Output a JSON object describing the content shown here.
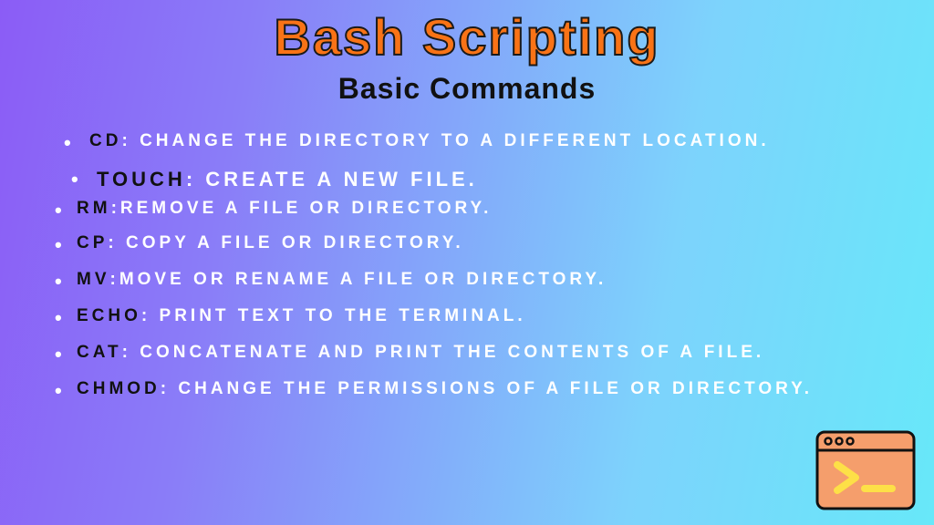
{
  "title": "Bash Scripting",
  "subtitle": "Basic Commands",
  "commands": [
    {
      "name": "CD",
      "sep": ": ",
      "desc": "CHANGE THE DIRECTORY TO A DIFFERENT LOCATION."
    },
    {
      "name": "TOUCH",
      "sep": ": ",
      "desc": "CREATE A NEW FILE."
    },
    {
      "name": "RM",
      "sep": ":",
      "desc": "REMOVE A FILE OR DIRECTORY."
    },
    {
      "name": "CP",
      "sep": ": ",
      "desc": "COPY A FILE OR DIRECTORY."
    },
    {
      "name": "MV",
      "sep": ":",
      "desc": "MOVE OR RENAME A FILE OR DIRECTORY."
    },
    {
      "name": "ECHO",
      "sep": ": ",
      "desc": "PRINT TEXT TO THE TERMINAL."
    },
    {
      "name": "CAT",
      "sep": ": ",
      "desc": "CONCATENATE AND PRINT THE CONTENTS OF A FILE."
    },
    {
      "name": "CHMOD",
      "sep": ": ",
      "desc": "CHANGE THE PERMISSIONS OF A FILE OR DIRECTORY."
    }
  ]
}
